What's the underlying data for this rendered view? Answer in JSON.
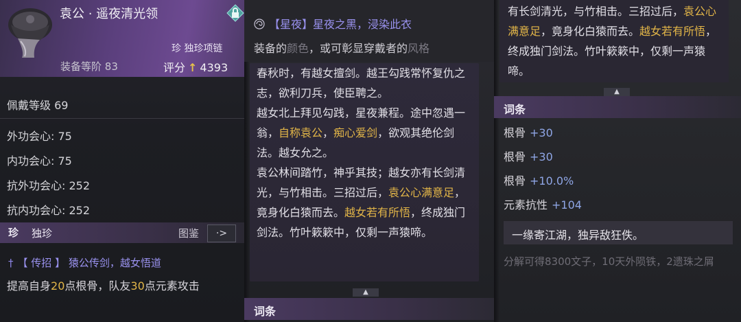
{
  "item": {
    "name": "袁公 · 遥夜清光领",
    "rarity_tag": "珍 独珍项链",
    "level_label": "装备等阶",
    "level_value": "83",
    "score_label": "评分",
    "score_value": "4393"
  },
  "stats": {
    "wear_level": "佩戴等级 69",
    "lines": [
      "外功会心: 75",
      "内功会心: 75",
      "抗外功会心: 252",
      "抗内功会心: 252"
    ]
  },
  "unique_section": {
    "badge": "珍",
    "title": "独珍",
    "atlas_label": "图鉴",
    "atlas_button_glyph": "·>"
  },
  "skill": {
    "bracket_open": "【",
    "type": "传招",
    "bracket_close": "】",
    "text": "猿公传剑，越女悟道"
  },
  "skill_desc": {
    "p1": "提高自身",
    "v1": "20",
    "p2": "点根骨，队友",
    "v2": "30",
    "p3": "点元素攻击"
  },
  "xingye": {
    "tag": "【星夜】",
    "text": "星夜之黑，浸染此衣"
  },
  "equip_note": {
    "a": "装备的",
    "b": "颜色",
    "c": "，或可彰显穿戴者的",
    "d": "风格"
  },
  "story": {
    "s1": "春秋时，有越女擅剑。越王勾践常怀复仇之志，欲利刀兵，使臣聘之。",
    "s2": "越女北上拜见勾践，星夜兼程。途中忽遇一翁，",
    "g1": "自称袁公",
    "s3": "，",
    "g2": "痴心爱剑",
    "s4": "，欲观其绝伦剑法。越女允之。",
    "s5": "袁公林间踏竹，神乎其技；越女亦有长剑清光，与竹相击。三招过后，",
    "g3": "袁公心满意足",
    "s6": "，竟身化白猿而去。",
    "g4": "越女若有所悟",
    "s7": "，终成独门剑法。竹叶簌簌中，仅剩一声猿啼。"
  },
  "story_cont": {
    "s1": "有长剑清光，与竹相击。三招过后，",
    "g1": "袁公心满意足",
    "s2": "，竟身化白猿而去。",
    "g2": "越女若有所悟",
    "s3": "，终成独门剑法。竹叶簌簌中，仅剩一声猿啼。"
  },
  "affix": {
    "title": "词条",
    "props": [
      {
        "label": "根骨",
        "value": "+30"
      },
      {
        "label": "根骨",
        "value": "+30"
      },
      {
        "label": "根骨",
        "value": "+10.0%"
      },
      {
        "label": "元素抗性",
        "value": "+104"
      }
    ]
  },
  "flavor": "一缘寄江湖，独异敌狂佚。",
  "decompose": "分解可得8300文子，10天外陨铁，2遗珠之屑",
  "colors": {
    "accent_purple": "#9a92ef",
    "gold": "#e3b648",
    "score_arrow": "#e6c24a",
    "header_purple": "#5a3f7c"
  },
  "icons": [
    "helmet-icon",
    "lock-icon",
    "sword-icon",
    "swirl-icon",
    "scroll-up-icon"
  ]
}
